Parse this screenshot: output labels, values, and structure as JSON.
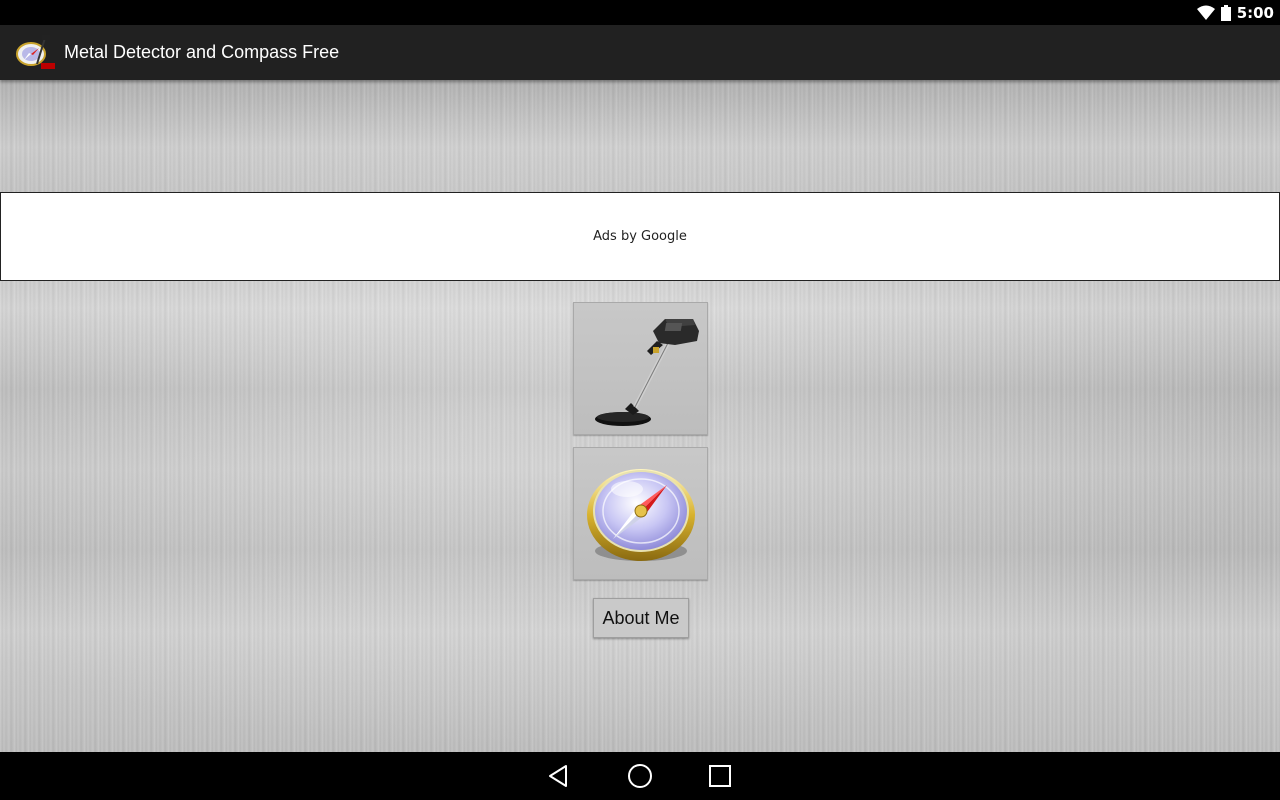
{
  "status_bar": {
    "time": "5:00",
    "icons": [
      "wifi-icon",
      "battery-icon"
    ]
  },
  "action_bar": {
    "app_icon": "metal-detector-compass-app-icon",
    "title": "Metal Detector and Compass Free"
  },
  "main": {
    "ad_banner": {
      "text": "Ads by Google"
    },
    "metal_detector_button": {
      "icon": "metal-detector-icon"
    },
    "compass_button": {
      "icon": "compass-icon"
    },
    "about_button": {
      "label": "About Me"
    }
  },
  "nav_bar": {
    "icons": [
      "back-icon",
      "home-icon",
      "recents-icon"
    ]
  },
  "colors": {
    "status_bar": "#000000",
    "action_bar": "#212121",
    "metal_bg": "#cfcfcf",
    "ad_bg": "#ffffff",
    "nav_bar": "#000000"
  }
}
